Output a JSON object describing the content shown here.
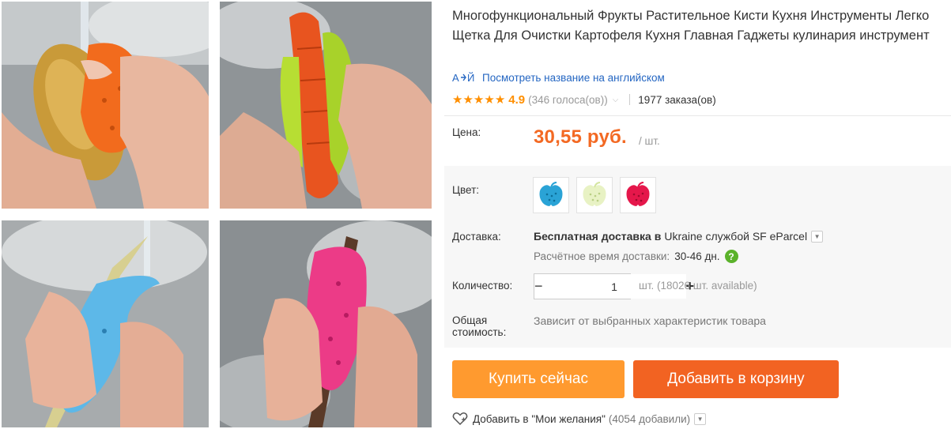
{
  "product": {
    "title": "Многофункциональный Фрукты Растительное Кисти Кухня Инструменты Легко Щетка Для Очистки Картофеля Кухня Главная Гаджеты кулинария инструмент",
    "translate_link": "Посмотреть название на английском",
    "rating": "4.9",
    "votes": "(346 голоса(ов))",
    "orders": "1977 заказа(ов)"
  },
  "price": {
    "label": "Цена:",
    "value": "30,55 руб.",
    "unit": "/ шт."
  },
  "color": {
    "label": "Цвет:",
    "options": [
      {
        "name": "blue",
        "hex": "#2aa3d6"
      },
      {
        "name": "light-green",
        "hex": "#e8f2c4"
      },
      {
        "name": "red",
        "hex": "#e5174b"
      }
    ]
  },
  "shipping": {
    "label": "Доставка:",
    "free_text": "Бесплатная доставка в",
    "destination_text": "Ukraine службой SF eParcel",
    "time_label": "Расчётное время доставки:",
    "time_value": "30-46 дн."
  },
  "quantity": {
    "label": "Количество:",
    "value": "1",
    "minus": "−",
    "plus": "+",
    "available": "шт. (18026 шт. available)"
  },
  "total": {
    "label": "Общая стоимость:",
    "value": "Зависит от выбранных характеристик товара"
  },
  "buttons": {
    "buy_now": "Купить сейчас",
    "add_to_cart": "Добавить в корзину"
  },
  "wishlist": {
    "text": "Добавить в \"Мои желания\"",
    "count": "(4054 добавили)"
  },
  "colors": {
    "accent_orange": "#f36923",
    "buy_button": "#ff9a2f",
    "cart_button": "#f26322",
    "link_blue": "#2466c2",
    "star": "#ff8f00"
  }
}
